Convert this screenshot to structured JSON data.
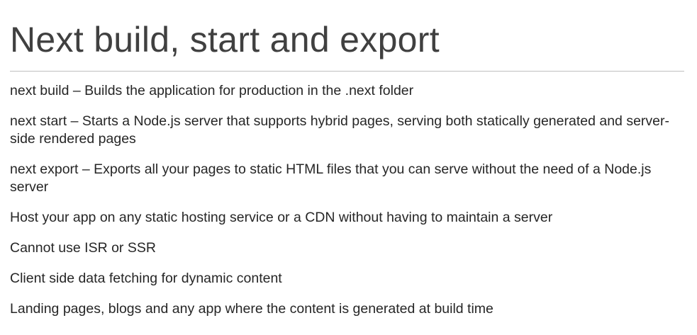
{
  "slide": {
    "title": "Next build, start and export",
    "items": [
      {
        "term": "next build",
        "separator": " – ",
        "text": "Builds the application for production in the .next folder"
      },
      {
        "term": "next start",
        "separator": " – ",
        "text": "Starts a Node.js server that supports hybrid pages, serving both statically generated and server-side rendered pages"
      },
      {
        "term": "next export",
        "separator": " – ",
        "text": "Exports all your pages to static HTML files that you can serve without the need of a Node.js server"
      },
      {
        "text": "Host your app on any static hosting service or a CDN without having to maintain a server"
      },
      {
        "text": "Cannot use ISR or SSR"
      },
      {
        "text": "Client side data fetching for dynamic content"
      },
      {
        "text": "Landing pages, blogs and any app where the content is generated at build time"
      }
    ]
  }
}
